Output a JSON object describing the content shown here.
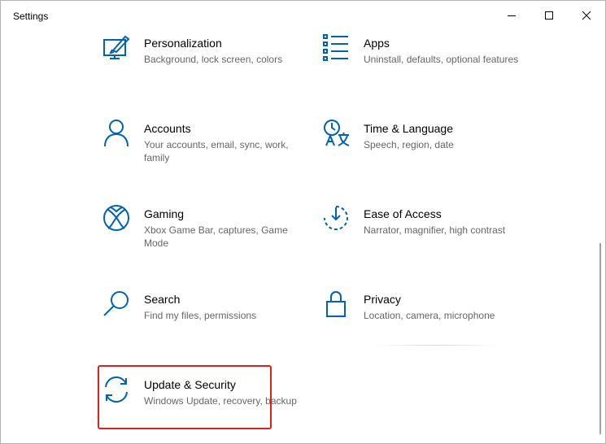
{
  "window": {
    "title": "Settings",
    "controls": {
      "minimize": "minimize-icon",
      "maximize": "maximize-icon",
      "close": "close-icon"
    }
  },
  "tiles": [
    {
      "title": "Personalization",
      "desc": "Background, lock screen, colors",
      "icon": "personalization-icon"
    },
    {
      "title": "Apps",
      "desc": "Uninstall, defaults, optional features",
      "icon": "apps-icon"
    },
    {
      "title": "Accounts",
      "desc": "Your accounts, email, sync, work, family",
      "icon": "accounts-icon"
    },
    {
      "title": "Time & Language",
      "desc": "Speech, region, date",
      "icon": "time-language-icon"
    },
    {
      "title": "Gaming",
      "desc": "Xbox Game Bar, captures, Game Mode",
      "icon": "xbox-icon"
    },
    {
      "title": "Ease of Access",
      "desc": "Narrator, magnifier, high contrast",
      "icon": "ease-of-access-icon"
    },
    {
      "title": "Search",
      "desc": "Find my files, permissions",
      "icon": "search-icon"
    },
    {
      "title": "Privacy",
      "desc": "Location, camera, microphone",
      "icon": "lock-icon"
    },
    {
      "title": "Update & Security",
      "desc": "Windows Update, recovery, backup",
      "icon": "update-icon"
    }
  ],
  "colors": {
    "accent": "#0063b1",
    "highlight": "#e02020",
    "desc_text": "#666666"
  }
}
